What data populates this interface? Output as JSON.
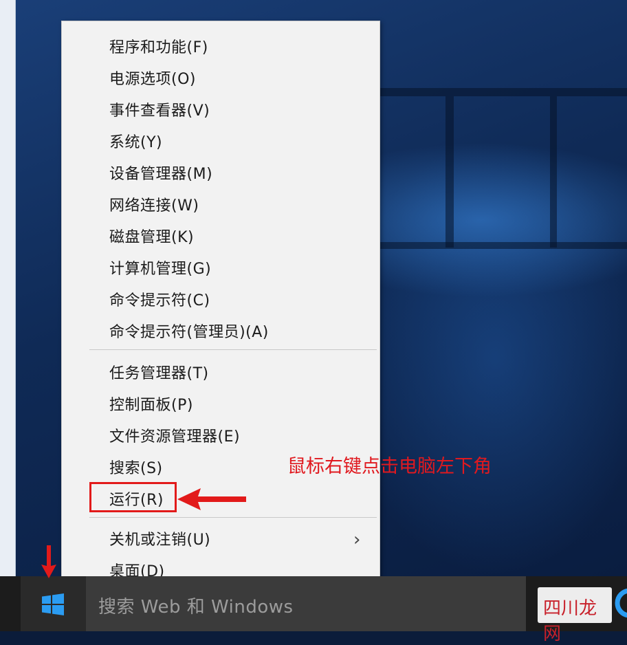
{
  "menu": {
    "group1": [
      {
        "label": "程序和功能(F)"
      },
      {
        "label": "电源选项(O)"
      },
      {
        "label": "事件查看器(V)"
      },
      {
        "label": "系统(Y)"
      },
      {
        "label": "设备管理器(M)"
      },
      {
        "label": "网络连接(W)"
      },
      {
        "label": "磁盘管理(K)"
      },
      {
        "label": "计算机管理(G)"
      },
      {
        "label": "命令提示符(C)"
      },
      {
        "label": "命令提示符(管理员)(A)"
      }
    ],
    "group2": [
      {
        "label": "任务管理器(T)"
      },
      {
        "label": "控制面板(P)"
      },
      {
        "label": "文件资源管理器(E)"
      },
      {
        "label": "搜索(S)"
      },
      {
        "label": "运行(R)"
      }
    ],
    "group3": [
      {
        "label": "关机或注销(U)",
        "submenu_icon": "chevron-right-icon"
      },
      {
        "label": "桌面(D)"
      }
    ]
  },
  "annotation": {
    "text": "鼠标右键点击电脑左下角",
    "color": "#e0191f",
    "highlighted_item": "运行(R)"
  },
  "taskbar": {
    "start_icon": "windows-logo-icon",
    "search_placeholder": "搜索 Web 和 Windows",
    "edge_icon": "edge-icon"
  },
  "watermark": {
    "text": "四川龙网"
  },
  "colors": {
    "accent_red": "#e21a1a",
    "windows_blue": "#2b9cf2",
    "menu_bg": "#f2f2f2",
    "taskbar_bg": "#1c1c1c"
  }
}
